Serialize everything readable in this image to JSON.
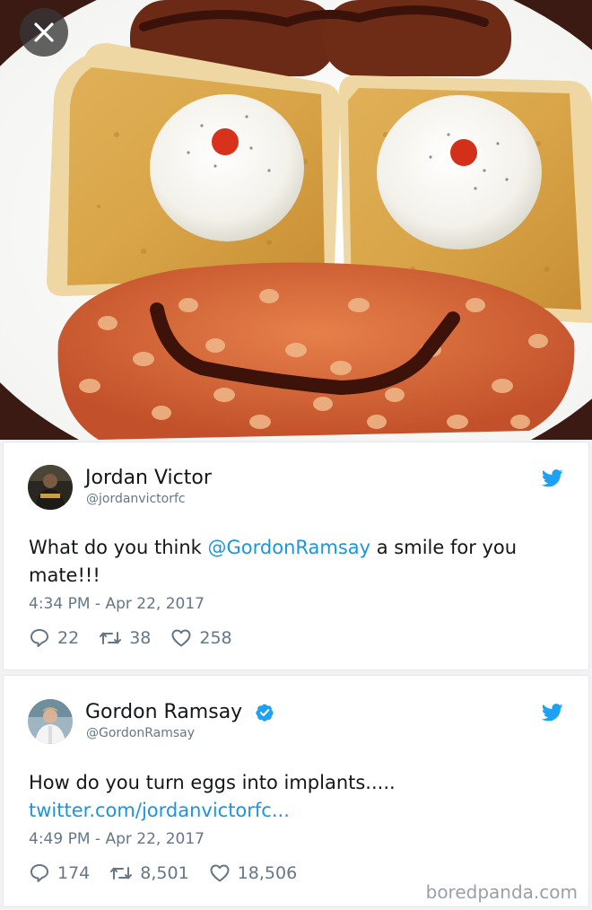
{
  "photo": {
    "close_icon": "close-icon"
  },
  "tweets": [
    {
      "name": "Jordan Victor",
      "handle": "@jordanvictorfc",
      "text_before": "What do you think ",
      "mention": "@GordonRamsay",
      "text_after": " a smile for you mate!!!",
      "time": "4:34 PM - Apr 22, 2017",
      "replies": "22",
      "retweets": "38",
      "likes": "258",
      "verified": false
    },
    {
      "name": "Gordon Ramsay",
      "handle": "@GordonRamsay",
      "text": "How do you turn eggs into implants.....",
      "link": "twitter.com/jordanvictorfc...",
      "time": "4:49 PM - Apr 22, 2017",
      "replies": "174",
      "retweets": "8,501",
      "likes": "18,506",
      "verified": true
    }
  ],
  "colors": {
    "link": "#1b95e0",
    "secondary_text": "#657786",
    "twitter_blue": "#1da1f2"
  },
  "icons": {
    "reply": "reply-icon",
    "retweet": "retweet-icon",
    "like": "heart-icon",
    "brand": "twitter-bird-icon",
    "verified": "verified-badge-icon"
  },
  "watermark": "boredpanda.com"
}
